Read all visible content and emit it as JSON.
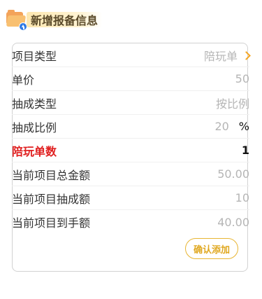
{
  "header": {
    "title": "新增报备信息",
    "icon": "folder-upload-icon"
  },
  "form": {
    "rows": [
      {
        "label": "项目类型",
        "value": "陪玩单",
        "has_chevron": true
      },
      {
        "label": "单价",
        "value": "50"
      },
      {
        "label": "抽成类型",
        "value": "按比例"
      },
      {
        "label": "抽成比例",
        "value": "20",
        "unit": "%"
      },
      {
        "label": "陪玩单数",
        "value": "1"
      },
      {
        "label": "当前项目总金额",
        "value": "50.00"
      },
      {
        "label": "当前项目抽成额",
        "value": "10"
      },
      {
        "label": "当前项目到手额",
        "value": "40.00"
      }
    ],
    "confirm_label": "确认添加"
  },
  "colors": {
    "accent": "#f5a623",
    "highlight_label": "#e02020",
    "placeholder_text": "#b5b5b5",
    "border": "#d2d2d2"
  }
}
